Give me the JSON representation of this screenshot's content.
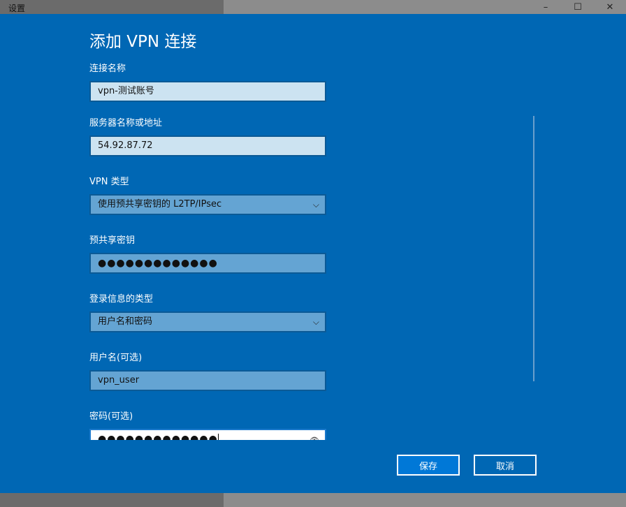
{
  "window": {
    "title": "设置",
    "minimize": "–",
    "maximize": "☐",
    "close": "✕"
  },
  "dialog": {
    "title": "添加 VPN 连接"
  },
  "fields": [
    {
      "label": "连接名称",
      "value": "vpn-测试账号"
    },
    {
      "label": "服务器名称或地址",
      "value": "54.92.87.72"
    },
    {
      "label": "VPN 类型",
      "value": "使用预共享密钥的 L2TP/IPsec"
    },
    {
      "label": "预共享密钥",
      "value": "●●●●●●●●●●●●●"
    },
    {
      "label": "登录信息的类型",
      "value": "用户名和密码"
    },
    {
      "label": "用户名(可选)",
      "value": "vpn_user"
    },
    {
      "label": "密码(可选)",
      "value": "●●●●●●●●●●●●●"
    }
  ],
  "icons": {
    "chevron": "⌵",
    "eye": "👁"
  },
  "buttons": {
    "save": "保存",
    "cancel": "取消"
  }
}
